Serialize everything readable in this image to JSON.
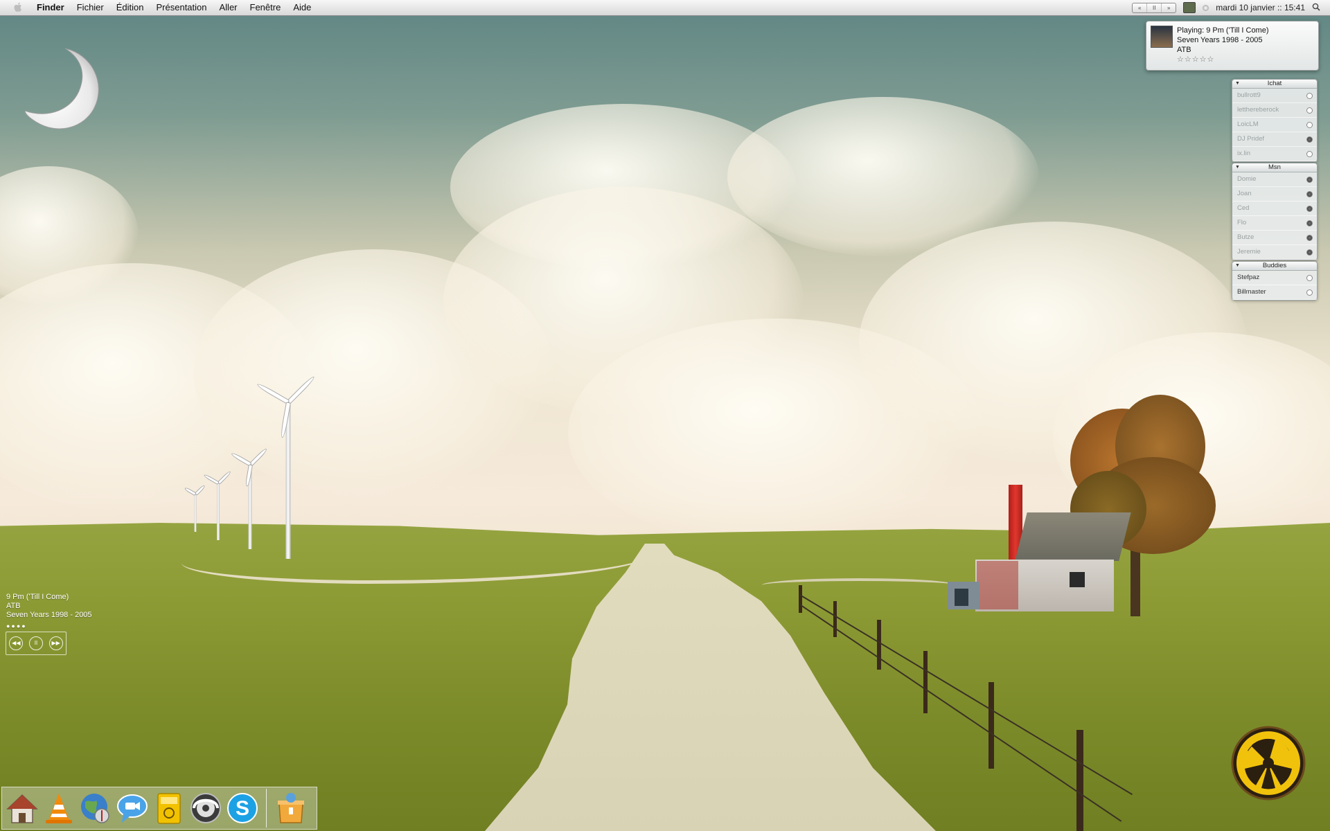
{
  "menubar": {
    "apple_icon": "apple-icon",
    "items": [
      {
        "label": "Finder",
        "bold": true
      },
      {
        "label": "Fichier"
      },
      {
        "label": "Édition"
      },
      {
        "label": "Présentation"
      },
      {
        "label": "Aller"
      },
      {
        "label": "Fenêtre"
      },
      {
        "label": "Aide"
      }
    ],
    "media_controls": [
      "«",
      "II",
      "»"
    ],
    "clock": "mardi 10 janvier :: 15:41",
    "spotlight_icon": "magnifier-icon"
  },
  "now_playing": {
    "line1": "Playing: 9 Pm ('Till I Come)",
    "line2": "Seven Years 1998 - 2005",
    "line3": "ATB",
    "rating": "☆☆☆☆☆"
  },
  "panels": {
    "ichat": {
      "title": "Ichat",
      "buddies": [
        {
          "name": "bullrott9",
          "status": "offline"
        },
        {
          "name": "letthereberock",
          "status": "offline"
        },
        {
          "name": "LoicLM",
          "status": "offline"
        },
        {
          "name": "DJ Pridef",
          "status": "offline"
        },
        {
          "name": "ix.lin",
          "status": "offline"
        }
      ]
    },
    "msn": {
      "title": "Msn",
      "buddies": [
        {
          "name": "Domie",
          "status": "offline"
        },
        {
          "name": "Joan",
          "status": "offline"
        },
        {
          "name": "Ced",
          "status": "offline"
        },
        {
          "name": "Flo",
          "status": "offline"
        },
        {
          "name": "Butze",
          "status": "offline"
        },
        {
          "name": "Jeremie",
          "status": "offline"
        }
      ]
    },
    "buddies": {
      "title": "Buddies",
      "buddies": [
        {
          "name": "Stefpaz",
          "status": "online"
        },
        {
          "name": "Billmaster",
          "status": "online"
        }
      ]
    }
  },
  "widget": {
    "track": "9 Pm ('Till I Come)",
    "artist": "ATB",
    "album": "Seven Years 1998 - 2005",
    "dots": "●●●●",
    "controls": [
      "◀◀",
      "II",
      "▶▶"
    ]
  },
  "dock": {
    "apps": [
      "home-icon",
      "vlc-icon",
      "safari-globe-icon",
      "ichat-icon",
      "mail-icon",
      "itunes-icon",
      "skype-icon"
    ],
    "extra": [
      "package-icon"
    ],
    "skype_letter": "S"
  }
}
